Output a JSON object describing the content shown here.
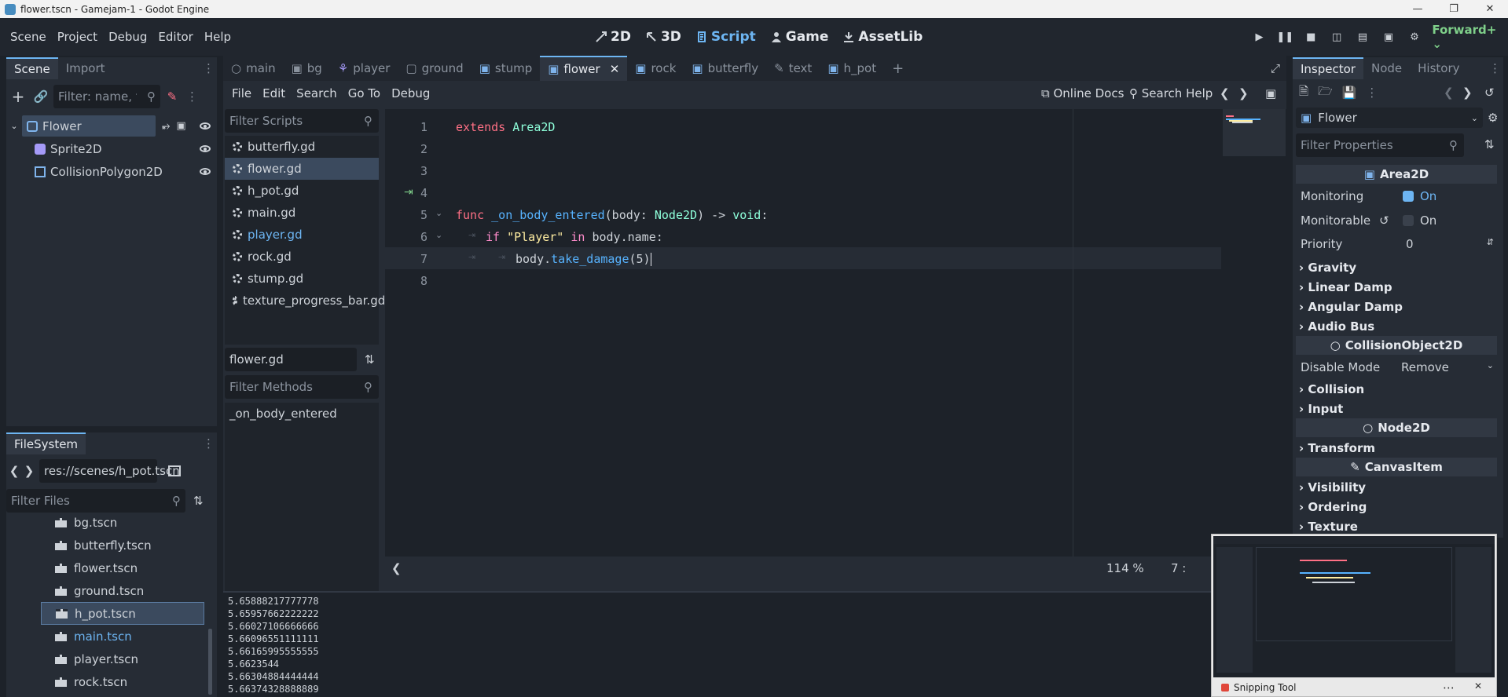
{
  "window": {
    "title": "flower.tscn - Gamejam-1 - Godot Engine"
  },
  "menu": {
    "items": [
      "Scene",
      "Project",
      "Debug",
      "Editor",
      "Help"
    ]
  },
  "modes": {
    "m2d": "2D",
    "m3d": "3D",
    "script": "Script",
    "game": "Game",
    "assetlib": "AssetLib"
  },
  "renderer": "Forward+",
  "scene_dock": {
    "tabs": {
      "scene": "Scene",
      "import": "Import"
    },
    "filter_placeholder": "Filter: name, t:t",
    "nodes": {
      "root": "Flower",
      "sprite": "Sprite2D",
      "collision": "CollisionPolygon2D"
    }
  },
  "filesystem": {
    "tab": "FileSystem",
    "path": "res://scenes/h_pot.tscn",
    "filter_placeholder": "Filter Files",
    "files": [
      "bg.tscn",
      "butterfly.tscn",
      "flower.tscn",
      "ground.tscn",
      "h_pot.tscn",
      "main.tscn",
      "player.tscn",
      "rock.tscn"
    ]
  },
  "editor_tabs": [
    "main",
    "bg",
    "player",
    "ground",
    "stump",
    "flower",
    "rock",
    "butterfly",
    "text",
    "h_pot"
  ],
  "script_menu": {
    "file": "File",
    "edit": "Edit",
    "search": "Search",
    "goto": "Go To",
    "debug": "Debug",
    "online_docs": "Online Docs",
    "search_help": "Search Help"
  },
  "scripts": {
    "filter_placeholder": "Filter Scripts",
    "list": [
      "butterfly.gd",
      "flower.gd",
      "h_pot.gd",
      "main.gd",
      "player.gd",
      "rock.gd",
      "stump.gd",
      "texture_progress_bar.gd"
    ],
    "current": "flower.gd",
    "methods_placeholder": "Filter Methods",
    "methods": [
      "_on_body_entered"
    ]
  },
  "code": {
    "line_numbers": [
      "1",
      "2",
      "3",
      "4",
      "5",
      "6",
      "7",
      "8"
    ],
    "l1_extends": "extends",
    "l1_type": "Area2D",
    "l5_func": "func",
    "l5_name": "_on_body_entered",
    "l5_open": "(body: ",
    "l5_type": "Node2D",
    "l5_arrow": ") -> ",
    "l5_void": "void",
    "l5_colon": ":",
    "l6_if": "if",
    "l6_str": "\"Player\"",
    "l6_in": "in",
    "l6_rest": "body.name:",
    "l7_obj": "body.",
    "l7_fn": "take_damage",
    "l7_args": "(5)"
  },
  "status": {
    "zoom": "114 %",
    "line": "7 :"
  },
  "output": {
    "lines": [
      "5.65888217777778",
      "5.65957662222222",
      "5.66027106666666",
      "5.66096551111111",
      "5.66165995555555",
      "5.6623544",
      "5.66304884444444",
      "5.66374328888889"
    ]
  },
  "inspector": {
    "tabs": {
      "inspector": "Inspector",
      "node": "Node",
      "history": "History"
    },
    "node_name": "Flower",
    "filter_placeholder": "Filter Properties",
    "class_area": "Area2D",
    "monitoring": {
      "label": "Monitoring",
      "value": "On"
    },
    "monitorable": {
      "label": "Monitorable",
      "value": "On"
    },
    "priority": {
      "label": "Priority",
      "value": "0"
    },
    "gravity": "Gravity",
    "linear_damp": "Linear Damp",
    "angular_damp": "Angular Damp",
    "audio_bus": "Audio Bus",
    "class_collision": "CollisionObject2D",
    "disable_mode": {
      "label": "Disable Mode",
      "value": "Remove"
    },
    "collision": "Collision",
    "input": "Input",
    "class_node2d": "Node2D",
    "transform": "Transform",
    "class_canvas": "CanvasItem",
    "visibility": "Visibility",
    "ordering": "Ordering",
    "texture": "Texture"
  },
  "snipping": {
    "title": "Snipping Tool"
  },
  "colors": {
    "accent": "#6db5f2",
    "renderer": "#7fd08a",
    "keyword": "#ff7085"
  }
}
